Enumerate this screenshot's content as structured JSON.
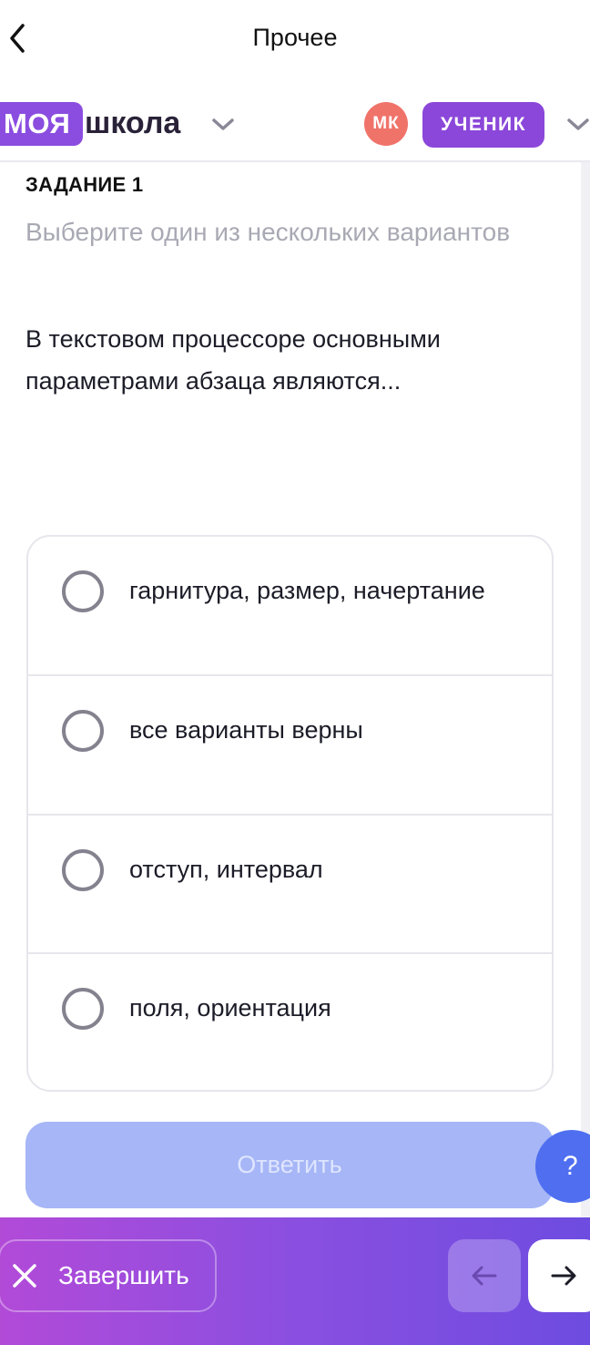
{
  "header": {
    "title": "Прочее",
    "back_icon": "chevron-left-icon"
  },
  "brand": {
    "logo_part1": "МОЯ",
    "logo_part2": "школа",
    "logo_color": "#8b4de0",
    "avatar_initials": "МК",
    "avatar_color": "#f0736a",
    "role": "УЧЕНИК",
    "role_color": "#8b47d9"
  },
  "task": {
    "label": "ЗАДАНИЕ 1",
    "instruction": "Выберите один из нескольких вариантов",
    "question": "В текстовом процессоре основными параметрами абзаца являются...",
    "options": [
      {
        "label": "гарнитура, размер, начертание",
        "selected": false
      },
      {
        "label": "все варианты верны",
        "selected": false
      },
      {
        "label": "отступ, интервал",
        "selected": false
      },
      {
        "label": "поля, ориентация",
        "selected": false
      }
    ]
  },
  "actions": {
    "answer_label": "Ответить",
    "answer_color": "#a6b6f6",
    "help_label": "?",
    "help_color": "#4f6ff0"
  },
  "footer": {
    "finish_label": "Завершить",
    "finish_icon": "close-icon",
    "prev_icon": "arrow-left-icon",
    "next_icon": "arrow-right-icon",
    "gradient_start": "#b24ad8",
    "gradient_end": "#6e4ce0"
  }
}
